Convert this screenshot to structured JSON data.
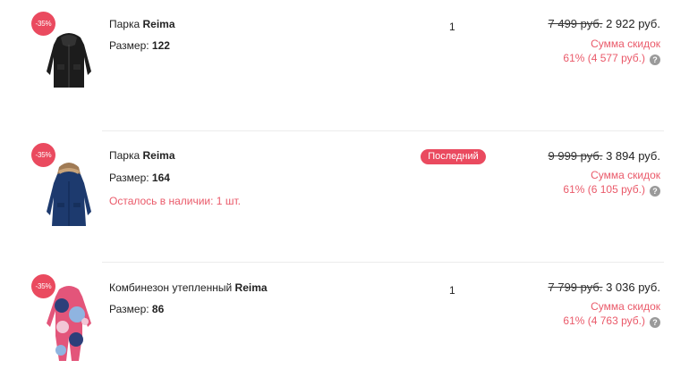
{
  "items": [
    {
      "badge": "-35%",
      "name_prefix": "Парка ",
      "brand": "Reima",
      "size_label": "Размер: ",
      "size_value": "122",
      "quantity": "1",
      "old_price": "7 499 руб.",
      "new_price": "2 922 руб.",
      "discount_label": "Сумма скидок",
      "discount_value": "61% (4 577 руб.)",
      "help_glyph": "?",
      "image": "black-parka"
    },
    {
      "badge": "-35%",
      "name_prefix": "Парка ",
      "brand": "Reima",
      "size_label": "Размер: ",
      "size_value": "164",
      "stock_text": "Осталось в наличии:  1  шт.",
      "last_badge": "Последний",
      "old_price": "9 999 руб.",
      "new_price": "3 894 руб.",
      "discount_label": "Сумма скидок",
      "discount_value": "61% (6 105 руб.)",
      "help_glyph": "?",
      "image": "navy-parka-fur-hood"
    },
    {
      "badge": "-35%",
      "name_prefix": "Комбинезон утепленный ",
      "brand": "Reima",
      "size_label": "Размер: ",
      "size_value": "86",
      "quantity": "1",
      "old_price": "7 799 руб.",
      "new_price": "3 036 руб.",
      "discount_label": "Сумма скидок",
      "discount_value": "61% (4 763 руб.)",
      "help_glyph": "?",
      "image": "printed-snowsuit"
    }
  ],
  "colors": {
    "accent": "#ea4a5f",
    "discount_text": "#ea5a6a",
    "help_icon": "#9a9a9a"
  }
}
